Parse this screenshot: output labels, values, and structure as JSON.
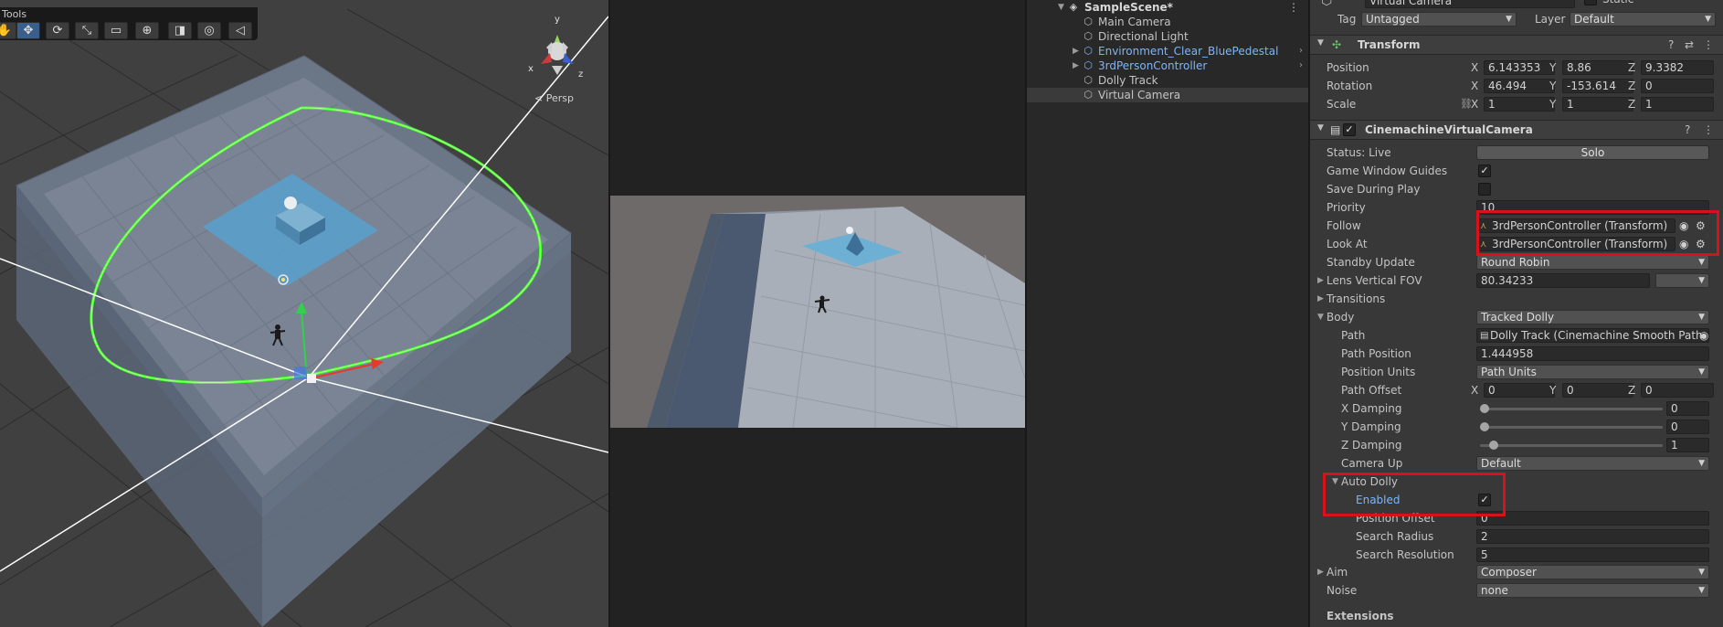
{
  "scene_view": {
    "tools_title": "Tools",
    "persp_label": "< Persp",
    "gizmo": {
      "y": "y",
      "x": "x",
      "z": "z"
    },
    "tools": [
      {
        "name": "hand-tool",
        "glyph": "✋"
      },
      {
        "name": "move-tool",
        "glyph": "✥"
      },
      {
        "name": "rotate-tool",
        "glyph": "⟳"
      },
      {
        "name": "scale-tool",
        "glyph": "⤡"
      },
      {
        "name": "rect-tool",
        "glyph": "▭"
      },
      {
        "name": "transform-tool",
        "glyph": "⊕"
      },
      {
        "name": "custom-tool-1",
        "glyph": "◨"
      },
      {
        "name": "custom-tool-2",
        "glyph": "◎"
      },
      {
        "name": "custom-tool-3",
        "glyph": "◁"
      }
    ]
  },
  "hierarchy": {
    "scene_name": "SampleScene*",
    "items": [
      {
        "label": "Main Camera",
        "prefab": false,
        "expandable": false
      },
      {
        "label": "Directional Light",
        "prefab": false,
        "expandable": false
      },
      {
        "label": "Environment_Clear_BluePedestal",
        "prefab": true,
        "expandable": true
      },
      {
        "label": "3rdPersonController",
        "prefab": true,
        "expandable": true
      },
      {
        "label": "Dolly Track",
        "prefab": false,
        "expandable": false
      },
      {
        "label": "Virtual Camera",
        "prefab": false,
        "expandable": false,
        "selected": true
      }
    ]
  },
  "inspector": {
    "object_name": "Virtual Camera",
    "static_label": "Static",
    "tag_label": "Tag",
    "tag_value": "Untagged",
    "layer_label": "Layer",
    "layer_value": "Default",
    "transform": {
      "title": "Transform",
      "position_label": "Position",
      "rotation_label": "Rotation",
      "scale_label": "Scale",
      "position": {
        "x": "6.143353",
        "y": "8.86",
        "z": "9.3382"
      },
      "rotation": {
        "x": "46.494",
        "y": "-153.614",
        "z": "0"
      },
      "scale": {
        "x": "1",
        "y": "1",
        "z": "1"
      }
    },
    "axis": {
      "x": "X",
      "y": "Y",
      "z": "Z"
    },
    "cvc": {
      "title": "CinemachineVirtualCamera",
      "status_label": "Status: Live",
      "solo_label": "Solo",
      "game_window_guides_label": "Game Window Guides",
      "save_during_play_label": "Save During Play",
      "priority_label": "Priority",
      "priority_value": "10",
      "follow_label": "Follow",
      "follow_value": "3rdPersonController (Transform)",
      "look_at_label": "Look At",
      "look_at_value": "3rdPersonController (Transform)",
      "standby_label": "Standby Update",
      "standby_value": "Round Robin",
      "fov_label": "Lens Vertical FOV",
      "fov_value": "80.34233",
      "transitions_label": "Transitions",
      "body_label": "Body",
      "body_value": "Tracked Dolly",
      "path_label": "Path",
      "path_value": "Dolly Track (Cinemachine Smooth Path",
      "path_position_label": "Path Position",
      "path_position_value": "1.444958",
      "position_units_label": "Position Units",
      "position_units_value": "Path Units",
      "path_offset_label": "Path Offset",
      "path_offset": {
        "x": "0",
        "y": "0",
        "z": "0"
      },
      "x_damping_label": "X Damping",
      "x_damping_value": "0",
      "y_damping_label": "Y Damping",
      "y_damping_value": "0",
      "z_damping_label": "Z Damping",
      "z_damping_value": "1",
      "camera_up_label": "Camera Up",
      "camera_up_value": "Default",
      "auto_dolly_label": "Auto Dolly",
      "enabled_label": "Enabled",
      "auto_position_offset_label": "Position Offset",
      "auto_position_offset_value": "0",
      "search_radius_label": "Search Radius",
      "search_radius_value": "2",
      "search_resolution_label": "Search Resolution",
      "search_resolution_value": "5",
      "aim_label": "Aim",
      "aim_value": "Composer",
      "noise_label": "Noise",
      "noise_value": "none",
      "extensions_label": "Extensions"
    }
  }
}
